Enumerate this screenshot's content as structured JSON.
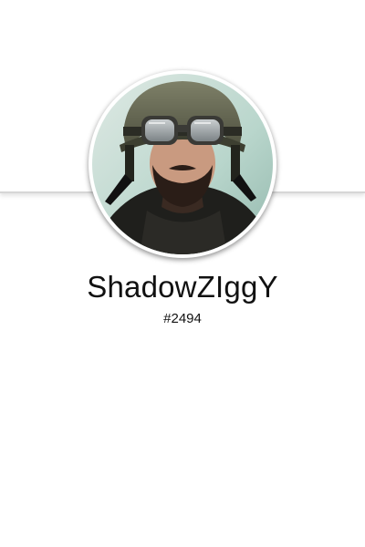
{
  "profile": {
    "username": "ShadowZIggY",
    "discriminator": "#2494",
    "avatar_icon": "soldier-helmet-goggles-avatar"
  },
  "colors": {
    "background": "#ffffff",
    "divider": "#d6d6d6",
    "text": "#111111"
  }
}
